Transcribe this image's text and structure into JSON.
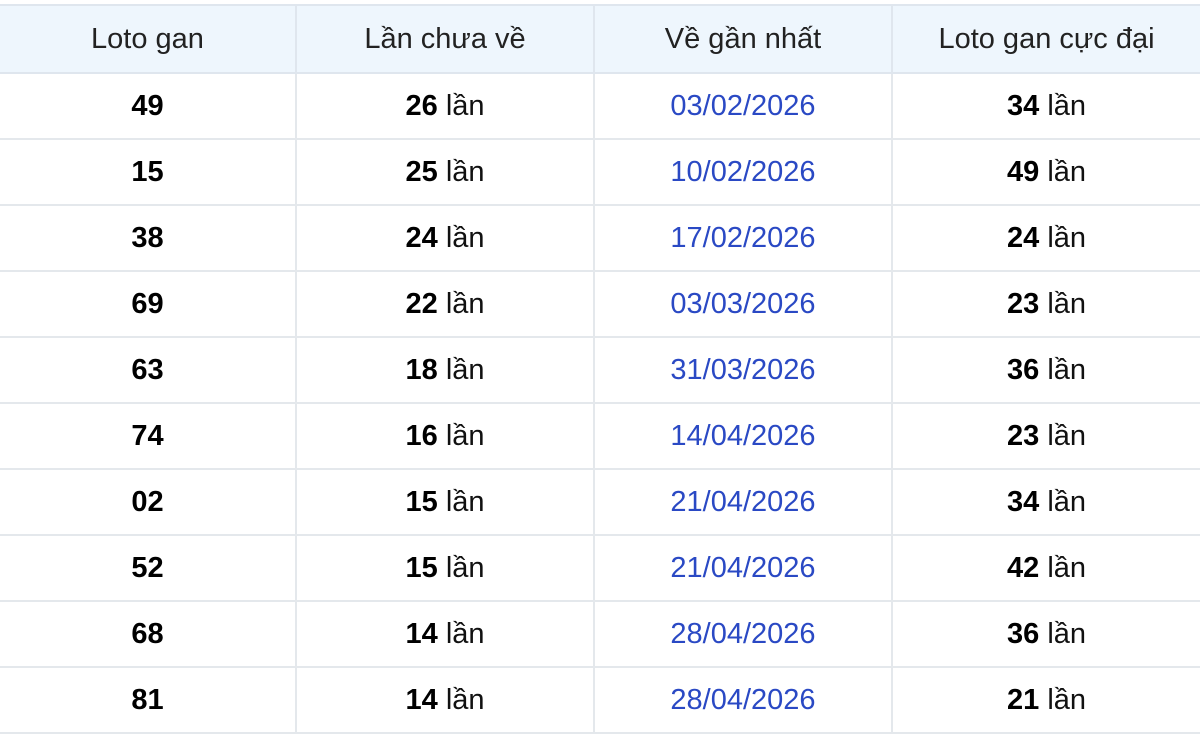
{
  "columns": [
    "Loto gan",
    "Lần chưa về",
    "Về gần nhất",
    "Loto gan cực đại"
  ],
  "unit": "lần",
  "rows": [
    {
      "number": "49",
      "missed": "26",
      "last_date": "03/02/2026",
      "max_gap": "34"
    },
    {
      "number": "15",
      "missed": "25",
      "last_date": "10/02/2026",
      "max_gap": "49"
    },
    {
      "number": "38",
      "missed": "24",
      "last_date": "17/02/2026",
      "max_gap": "24"
    },
    {
      "number": "69",
      "missed": "22",
      "last_date": "03/03/2026",
      "max_gap": "23"
    },
    {
      "number": "63",
      "missed": "18",
      "last_date": "31/03/2026",
      "max_gap": "36"
    },
    {
      "number": "74",
      "missed": "16",
      "last_date": "14/04/2026",
      "max_gap": "23"
    },
    {
      "number": "02",
      "missed": "15",
      "last_date": "21/04/2026",
      "max_gap": "34"
    },
    {
      "number": "52",
      "missed": "15",
      "last_date": "21/04/2026",
      "max_gap": "42"
    },
    {
      "number": "68",
      "missed": "14",
      "last_date": "28/04/2026",
      "max_gap": "36"
    },
    {
      "number": "81",
      "missed": "14",
      "last_date": "28/04/2026",
      "max_gap": "21"
    }
  ],
  "colors": {
    "header_background": "#eef6fd",
    "date_text": "#2a49c4",
    "grid_line": "#e4e8ec"
  }
}
